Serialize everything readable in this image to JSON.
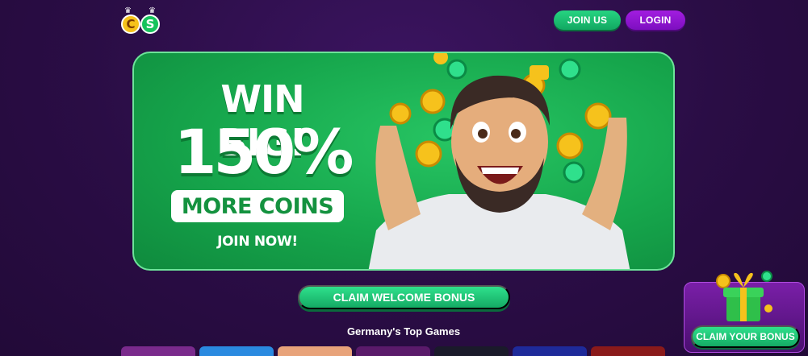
{
  "header": {
    "logo_text": "CS",
    "logo_letters": [
      "C",
      "S"
    ],
    "join_label": "JOIN US",
    "login_label": "LOGIN"
  },
  "banner": {
    "title": "WIN BIG!",
    "percent": "150%",
    "pill_text": "MORE COINS",
    "cta_text": "JOIN NOW!"
  },
  "claim_welcome_label": "CLAIM WELCOME BONUS",
  "games_section": {
    "title": "Germany's Top Games"
  },
  "bonus_widget": {
    "claim_label": "CLAIM YOUR BONUS"
  },
  "colors": {
    "background": "#2a0d45",
    "accent_green": "#16a64c",
    "accent_purple": "#8a14d0",
    "coin_gold": "#f6c21c"
  },
  "icons": [
    "crown-icon",
    "coin-icon",
    "gift-icon"
  ]
}
